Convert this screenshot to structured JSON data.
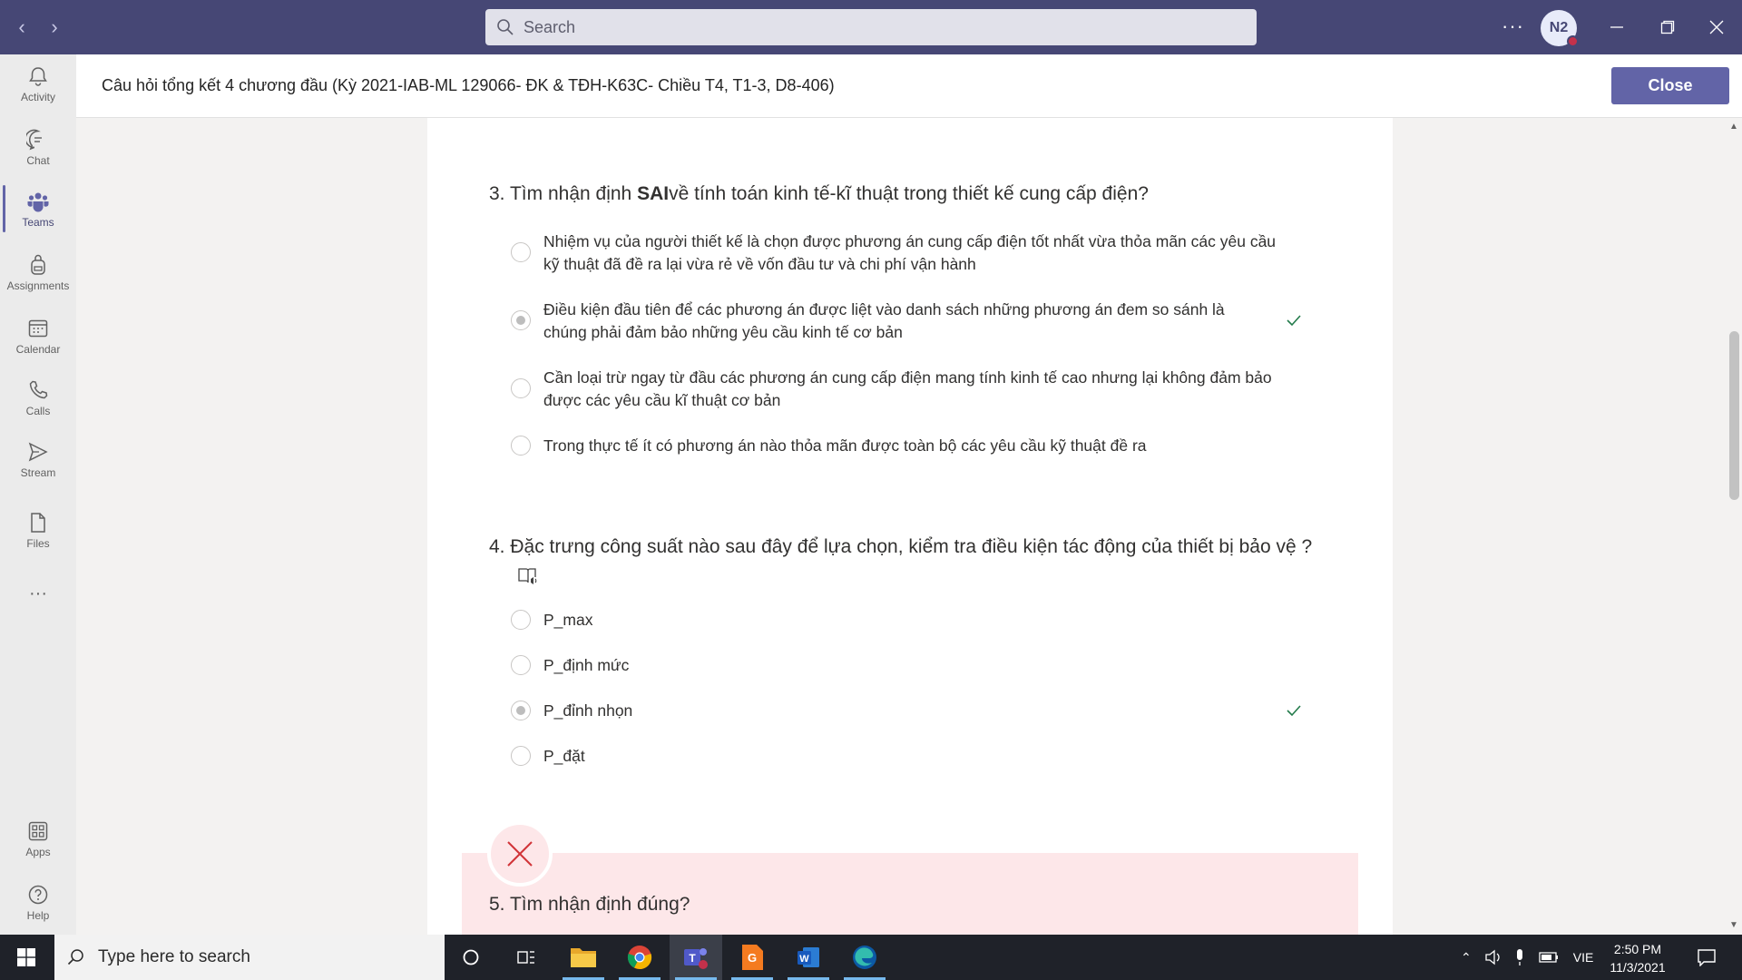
{
  "titlebar": {
    "search_placeholder": "Search",
    "avatar_initials": "N2"
  },
  "rail": {
    "items": [
      {
        "label": "Activity",
        "icon": "bell-icon"
      },
      {
        "label": "Chat",
        "icon": "chat-icon"
      },
      {
        "label": "Teams",
        "icon": "teams-icon"
      },
      {
        "label": "Assignments",
        "icon": "backpack-icon"
      },
      {
        "label": "Calendar",
        "icon": "calendar-icon"
      },
      {
        "label": "Calls",
        "icon": "phone-icon"
      },
      {
        "label": "Stream",
        "icon": "stream-icon"
      },
      {
        "label": "Files",
        "icon": "file-icon"
      },
      {
        "label": "Apps",
        "icon": "apps-icon"
      },
      {
        "label": "Help",
        "icon": "help-icon"
      }
    ],
    "more": "···"
  },
  "header": {
    "title": "Câu hỏi tổng kết 4 chương đầu (Kỳ 2021-IAB-ML 129066- ĐK & TĐH-K63C- Chiều T4, T1-3, D8-406)",
    "close_label": "Close"
  },
  "quiz": {
    "q3": {
      "prefix": "3. Tìm nhận định ",
      "bold": "SAI",
      "suffix": "về tính toán kinh tế-kĩ thuật trong thiết kế cung cấp điện?",
      "options": [
        {
          "line1": "Nhiệm vụ của người thiết kế là chọn được phương án cung cấp điện tốt nhất vừa thỏa mãn các yêu cầu",
          "line2": "kỹ thuật đã đề ra lại vừa rẻ về vốn đầu tư và chi phí vận hành"
        },
        {
          "line1": "Điều kiện đầu tiên để các phương án được liệt vào danh sách những phương án đem so sánh là",
          "line2": "chúng phải đảm bảo những yêu cầu kinh tế cơ bản"
        },
        {
          "line1": "Cần loại trừ ngay từ đầu các phương án cung cấp điện mang tính kinh tế cao nhưng lại không đảm bảo",
          "line2": "được các yêu cầu kĩ thuật cơ bản"
        },
        {
          "line1": "Trong thực tế ít có phương án nào thỏa mãn được toàn bộ các yêu cầu kỹ thuật đề ra",
          "line2": ""
        }
      ]
    },
    "q4": {
      "text": "4. Đặc trưng công suất nào sau đây để lựa chọn, kiểm tra điều kiện tác động của thiết bị bảo vệ ?",
      "options": [
        "P_max",
        "P_định mức",
        "P_đỉnh nhọn",
        "P_đặt"
      ]
    },
    "q5": {
      "text": "5. Tìm nhận định đúng?"
    }
  },
  "taskbar": {
    "search_placeholder": "Type here to search",
    "language": "VIE",
    "time": "2:50 PM",
    "date": "11/3/2021"
  },
  "colors": {
    "titlebar": "#464775",
    "accent": "#6264a7",
    "check": "#237b4b",
    "wrong_bg": "#fde7e9",
    "wrong_x": "#d13438"
  }
}
